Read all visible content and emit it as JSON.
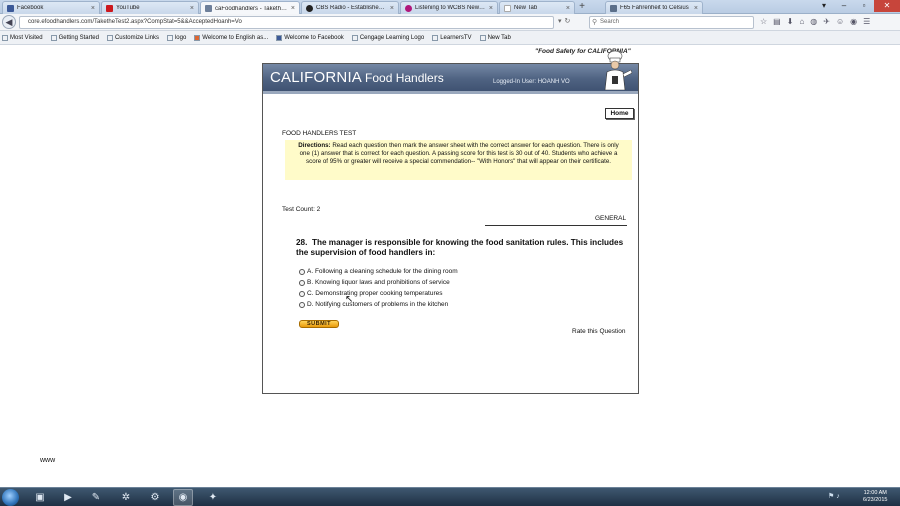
{
  "browser": {
    "tabs": [
      {
        "title": "Facebook",
        "icon": "facebook-icon",
        "color": "#3b5998",
        "active": false
      },
      {
        "title": "YouTube",
        "icon": "youtube-icon",
        "color": "#cc181e",
        "active": false
      },
      {
        "title": "caFoodhandlers - TaketheT...",
        "icon": "page-icon",
        "color": "#6d7f9a",
        "active": true
      },
      {
        "title": "CBS Radio - Established 1928",
        "icon": "cbs-icon",
        "color": "#222222",
        "active": false
      },
      {
        "title": "Listening to WCBS Newsra...",
        "icon": "radio-icon",
        "color": "#b0177b",
        "active": false
      },
      {
        "title": "New Tab",
        "icon": "blank-page-icon",
        "color": "#cccccc",
        "active": false
      },
      {
        "title": "F65 Fahrenheit to Celsius",
        "icon": "page-icon",
        "color": "#5b6f8a",
        "active": false
      }
    ],
    "url": "core.efoodhandlers.com/TaketheTest2.aspx?CompStat=5&&AcceptedHoanh=Vo",
    "search_placeholder": "Search",
    "bookmarks": [
      "Most Visited",
      "Getting Started",
      "Customize Links",
      "logo",
      "Welcome to English as...",
      "Welcome to Facebook",
      "Cengage Learning Logo",
      "LearnersTV",
      "New Tab"
    ]
  },
  "site": {
    "tagline": "\"Food Safety for CALIFORNIA\"",
    "logo_main": "CALIFORNIA",
    "logo_sub": "Food Handlers",
    "logged_in": "Logged-In User: HOANH VO",
    "home_label": "Home",
    "test_title": "FOOD HANDLERS TEST",
    "directions_label": "Directions:",
    "directions_text": " Read each question then mark the answer sheet with the correct answer for each question. There is only one (1) answer that is correct for each question. A passing score for this test is 30 out of 40. Students who achieve a score of 95% or greater will receive a special commendation-- \"With Honors\" that will appear on their certificate.",
    "test_count": "Test Count: 2",
    "category": "GENERAL",
    "question_number": "28.",
    "question_text": "The manager is responsible for knowing the food sanitation rules. This includes the supervision of food handlers in:",
    "answers": [
      "A. Following a cleaning schedule for the dining room",
      "B. Knowing liquor laws and prohibitions of service",
      "C. Demonstrating proper cooking temperatures",
      "D. Notifying customers of problems in the kitchen"
    ],
    "submit_label": "SUBMIT",
    "rate_label": "Rate this Question"
  },
  "watermark": "www",
  "taskbar": {
    "clock_time": "12:00 AM",
    "clock_date": "6/23/2015"
  }
}
